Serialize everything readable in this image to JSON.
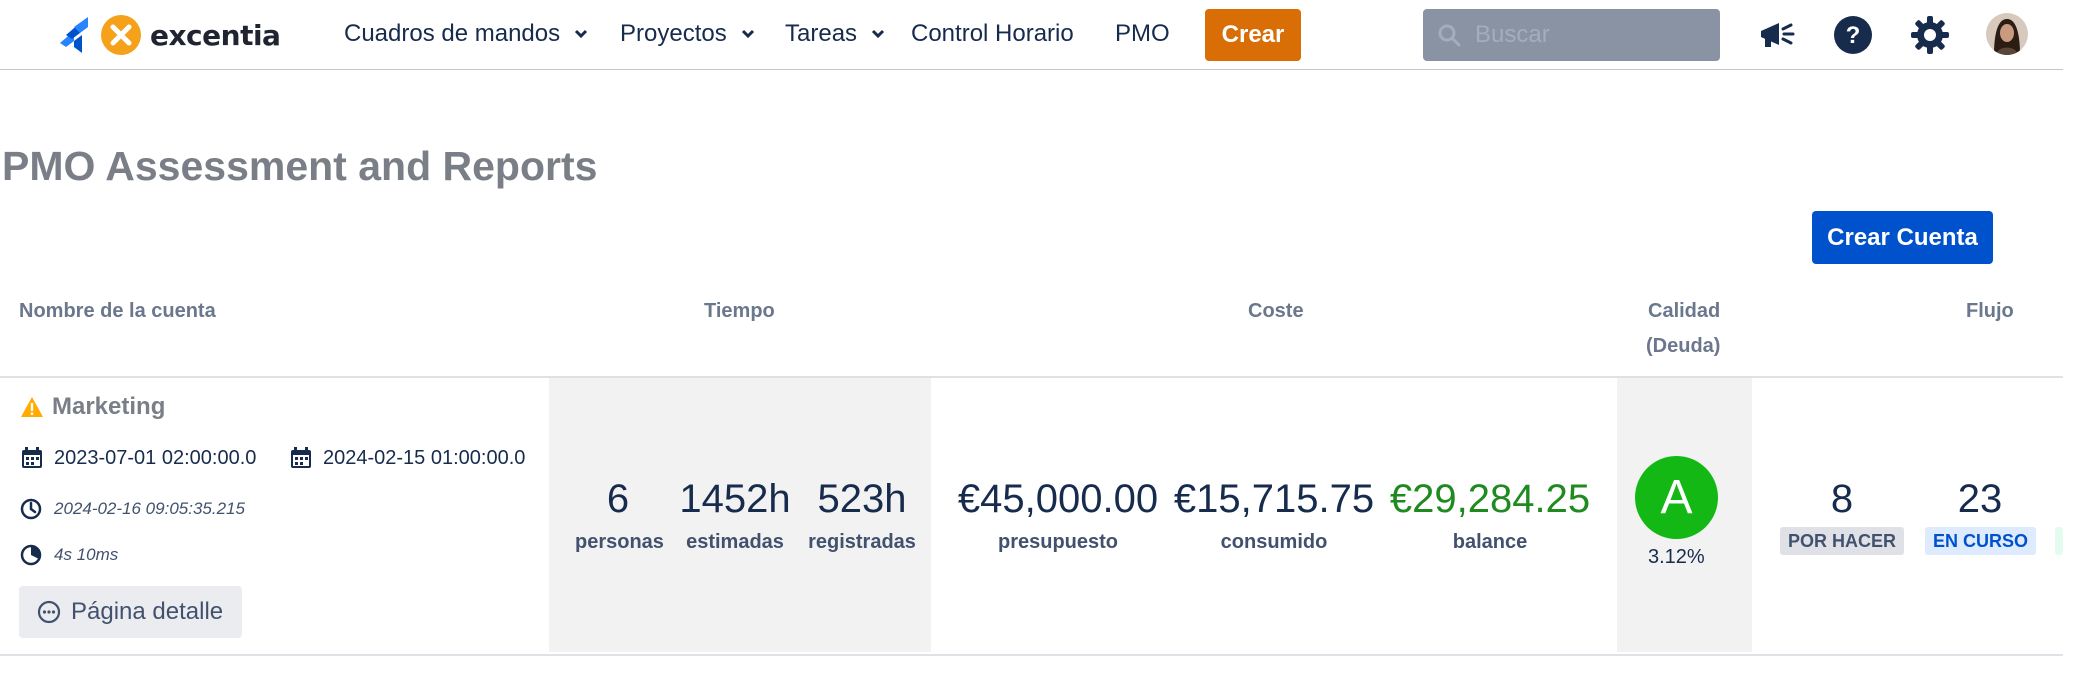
{
  "nav": {
    "logo_text": "excentia",
    "items": [
      {
        "label": "Cuadros de mandos",
        "has_dropdown": true
      },
      {
        "label": "Proyectos",
        "has_dropdown": true
      },
      {
        "label": "Tareas",
        "has_dropdown": true
      },
      {
        "label": "Control Horario",
        "has_dropdown": false
      },
      {
        "label": "PMO",
        "has_dropdown": false
      }
    ],
    "create_label": "Crear",
    "search_placeholder": "Buscar",
    "icons": [
      "megaphone-icon",
      "help-icon",
      "settings-icon"
    ],
    "colors": {
      "create": "#d96e06",
      "search_bg": "#8993a4"
    }
  },
  "page": {
    "title": "PMO Assessment and Reports",
    "create_account_label": "Crear Cuenta"
  },
  "table": {
    "headers": {
      "account": "Nombre de la cuenta",
      "time": "Tiempo",
      "cost": "Coste",
      "quality_line1": "Calidad",
      "quality_line2": "(Deuda)",
      "flow": "Flujo"
    },
    "rows": [
      {
        "name": "Marketing",
        "status_icon": "warning-icon",
        "start_date": "2023-07-01 02:00:00.0",
        "end_date": "2024-02-15 01:00:00.0",
        "updated_at": "2024-02-16 09:05:35.215",
        "duration": "4s 10ms",
        "detail_label": "Página detalle",
        "time": {
          "people": "6",
          "people_label": "personas",
          "estimated": "1452h",
          "estimated_label": "estimadas",
          "logged": "523h",
          "logged_label": "registradas"
        },
        "cost": {
          "budget": "€45,000.00",
          "budget_label": "presupuesto",
          "consumed": "€15,715.75",
          "consumed_label": "consumido",
          "balance": "€29,284.25",
          "balance_label": "balance"
        },
        "quality": {
          "grade": "A",
          "debt_pct": "3.12%",
          "grade_color": "#14b814"
        },
        "flow": {
          "todo": "8",
          "todo_label": "POR HACER",
          "in_progress": "23",
          "in_progress_label": "EN CURSO"
        }
      }
    ]
  }
}
